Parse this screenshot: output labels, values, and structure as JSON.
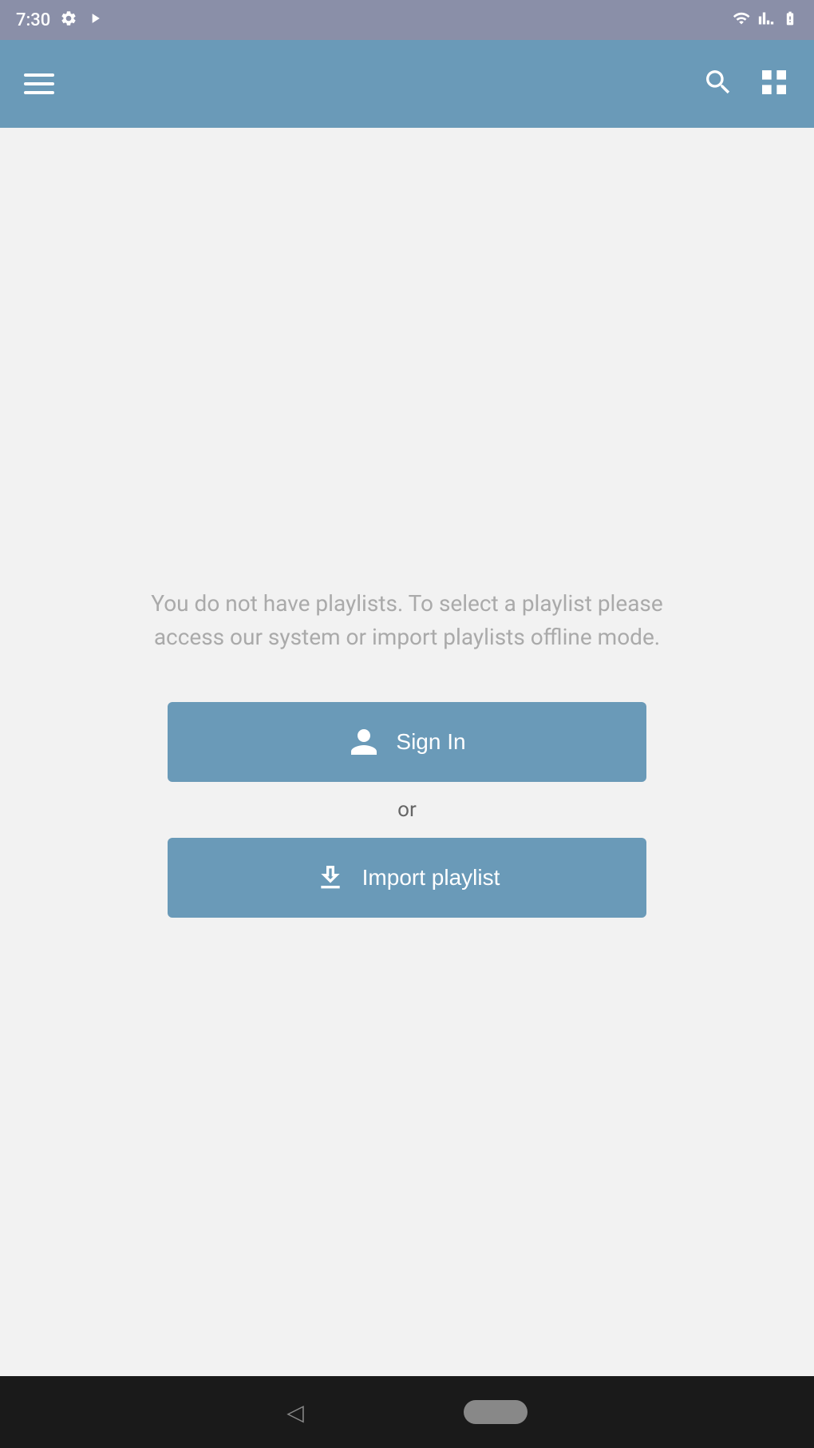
{
  "status_bar": {
    "time": "7:30",
    "icons": [
      "settings",
      "play",
      "wifi",
      "signal",
      "battery"
    ]
  },
  "toolbar": {
    "menu_icon": "hamburger-menu",
    "search_icon": "search",
    "grid_icon": "grid-view"
  },
  "main": {
    "empty_message": "You do not have playlists. To select a playlist please access our system or import playlists offline mode.",
    "sign_in_label": "Sign In",
    "or_label": "or",
    "import_playlist_label": "Import playlist"
  },
  "bottom_nav": {
    "back_label": "◁",
    "home_label": ""
  }
}
